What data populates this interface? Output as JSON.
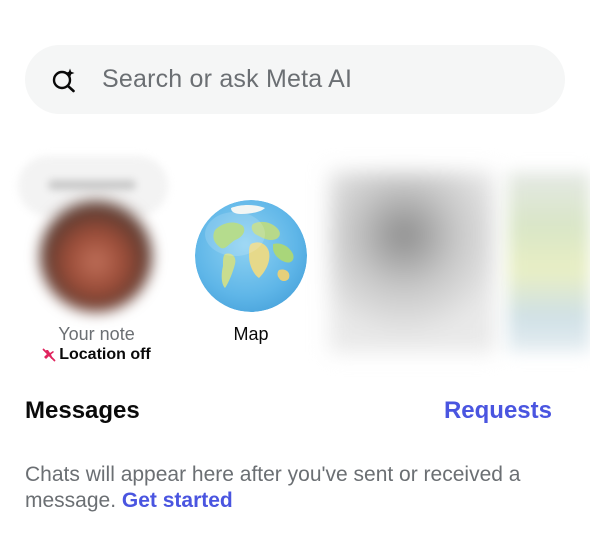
{
  "search": {
    "placeholder": "Search or ask Meta AI",
    "icon": "meta-ai-search-icon"
  },
  "notes": {
    "your_note": {
      "label": "Your note",
      "location_status": "Location off",
      "location_icon": "location-off-icon"
    },
    "map": {
      "label": "Map",
      "icon": "globe-map-icon"
    }
  },
  "messages": {
    "title": "Messages",
    "requests_label": "Requests"
  },
  "empty_state": {
    "text": "Chats will appear here after you've sent or received a message.",
    "link": "Get started"
  },
  "colors": {
    "accent": "#4a55e0",
    "location_off_icon": "#e0245e",
    "muted_text": "#6b6f73",
    "search_bg": "#f5f6f6"
  }
}
